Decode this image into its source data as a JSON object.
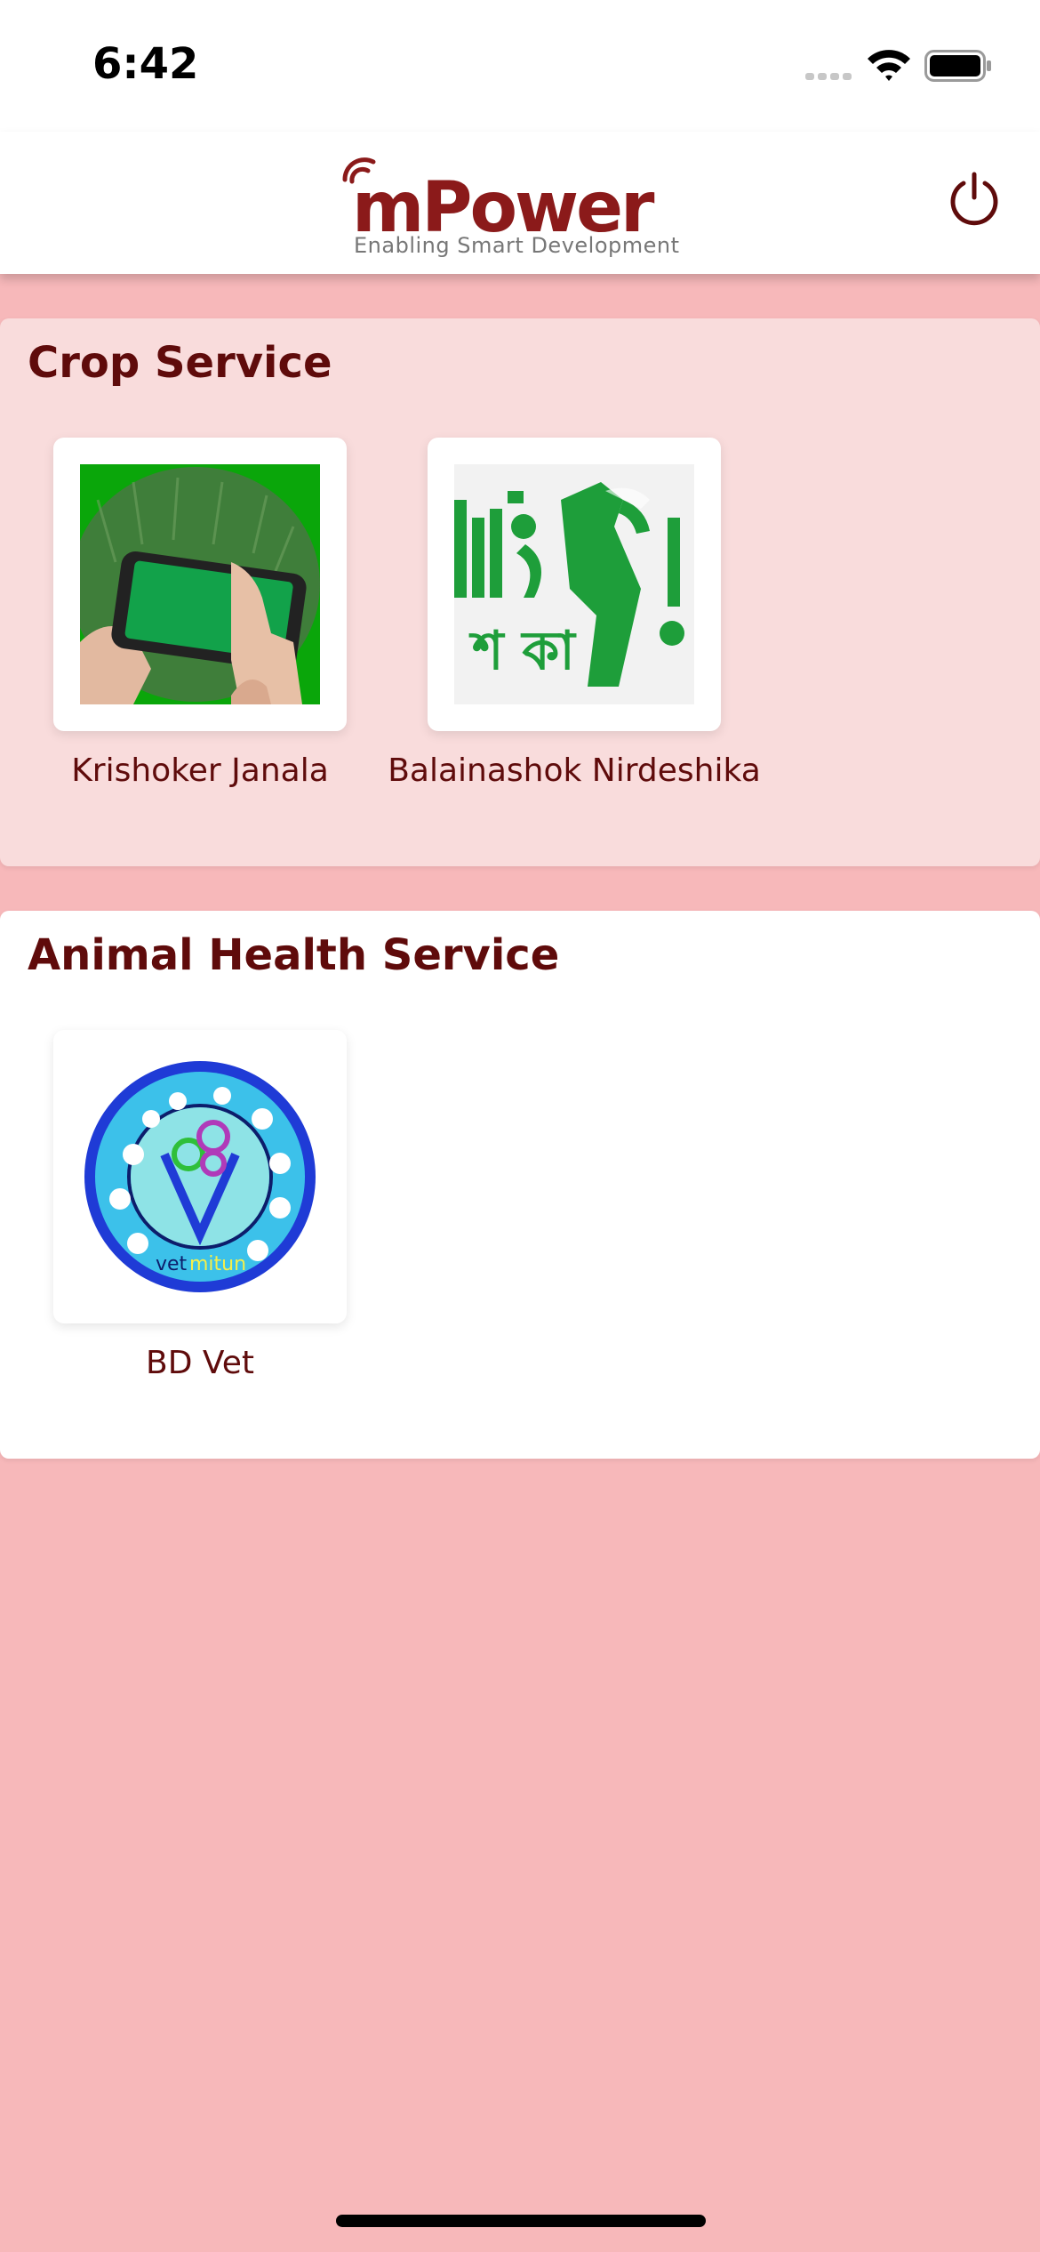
{
  "status_bar": {
    "time": "6:42"
  },
  "header": {
    "logo_text": "mPower",
    "logo_tagline": "Enabling Smart Development",
    "power_icon": "power-icon",
    "brand_color": "#8b1a1a"
  },
  "sections": [
    {
      "title": "Crop Service",
      "items": [
        {
          "label": "Krishoker Janala",
          "icon": "phone-in-field-image"
        },
        {
          "label": "Balainashok Nirdeshika",
          "icon": "bengali-logo-image"
        }
      ]
    },
    {
      "title": "Animal Health Service",
      "items": [
        {
          "label": "BD Vet",
          "icon": "vetmitun-logo-image",
          "logo_text_a": "vet",
          "logo_text_b": "mitun"
        }
      ]
    }
  ],
  "colors": {
    "page_background": "#f7b8ba",
    "crop_card": "#f9dcdc",
    "title_text": "#5f0b0b"
  }
}
